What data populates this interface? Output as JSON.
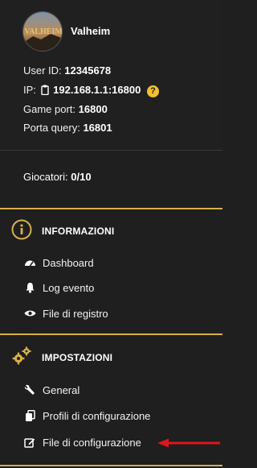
{
  "server": {
    "name": "Valheim",
    "avatar_text": "VALHEIM"
  },
  "info": {
    "user_id_label": "User ID:",
    "user_id_value": "12345678",
    "ip_label": "IP:",
    "ip_value": "192.168.1.1:16800",
    "help_symbol": "?",
    "game_port_label": "Game port:",
    "game_port_value": "16800",
    "query_port_label": "Porta query:",
    "query_port_value": "16801"
  },
  "players": {
    "label": "Giocatori:",
    "value": "0/10"
  },
  "sections": {
    "info": {
      "title": "INFORMAZIONI",
      "icon": "info-circle-icon",
      "items": [
        {
          "label": "Dashboard",
          "icon": "gauge-icon"
        },
        {
          "label": "Log evento",
          "icon": "bell-icon"
        },
        {
          "label": "File di registro",
          "icon": "eye-icon"
        }
      ]
    },
    "settings": {
      "title": "IMPOSTAZIONI",
      "icon": "gears-icon",
      "items": [
        {
          "label": "General",
          "icon": "wrench-icon"
        },
        {
          "label": "Profili di configurazione",
          "icon": "copy-icon"
        },
        {
          "label": "File di configurazione",
          "icon": "edit-icon"
        }
      ]
    }
  },
  "colors": {
    "background": "#1f1f1f",
    "accent": "#d7b04a",
    "help_badge": "#f2c12e",
    "arrow": "#e0141e"
  }
}
